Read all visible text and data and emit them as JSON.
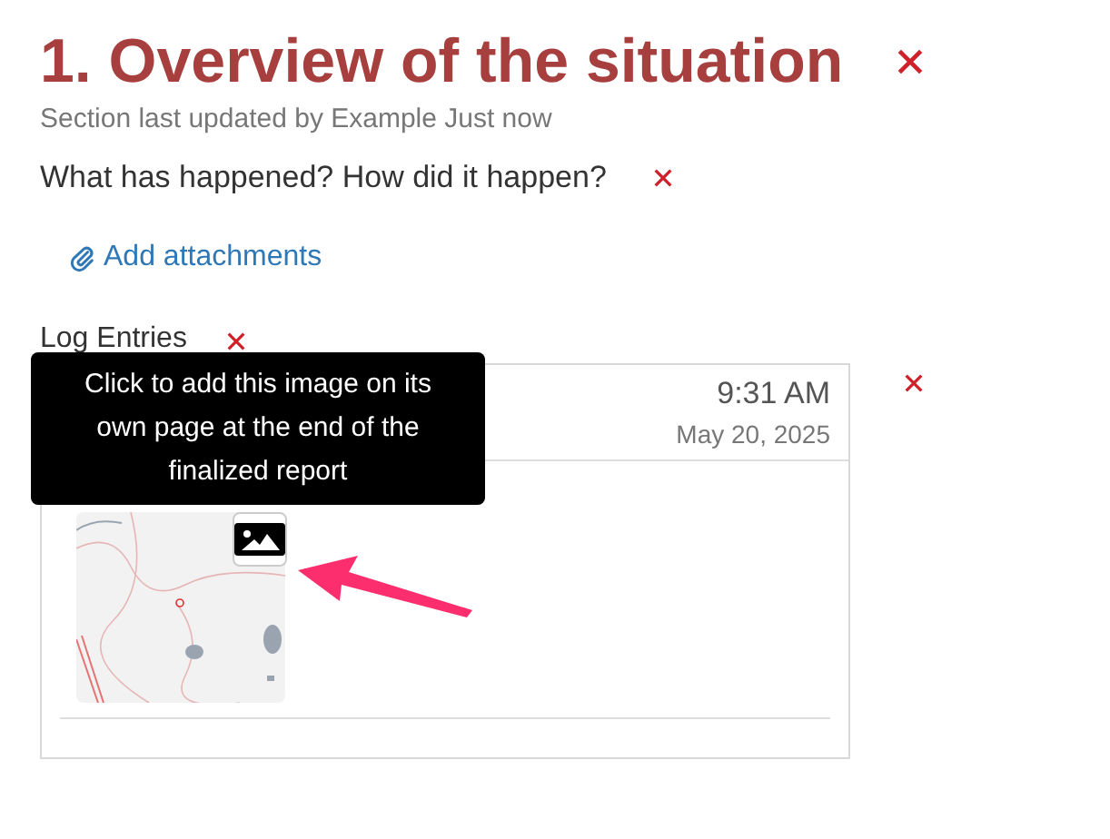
{
  "section": {
    "title": "1. Overview of the situation",
    "subtitle": "Section last updated by Example Just now"
  },
  "question": {
    "text": "What has happened? How did it happen?"
  },
  "attachments": {
    "label": "Add attachments"
  },
  "log": {
    "label": "Log Entries",
    "entry": {
      "time": "9:31 AM",
      "date": "May 20, 2025"
    },
    "tooltip": "Click to add this image on its own page at the end of the finalized report"
  }
}
